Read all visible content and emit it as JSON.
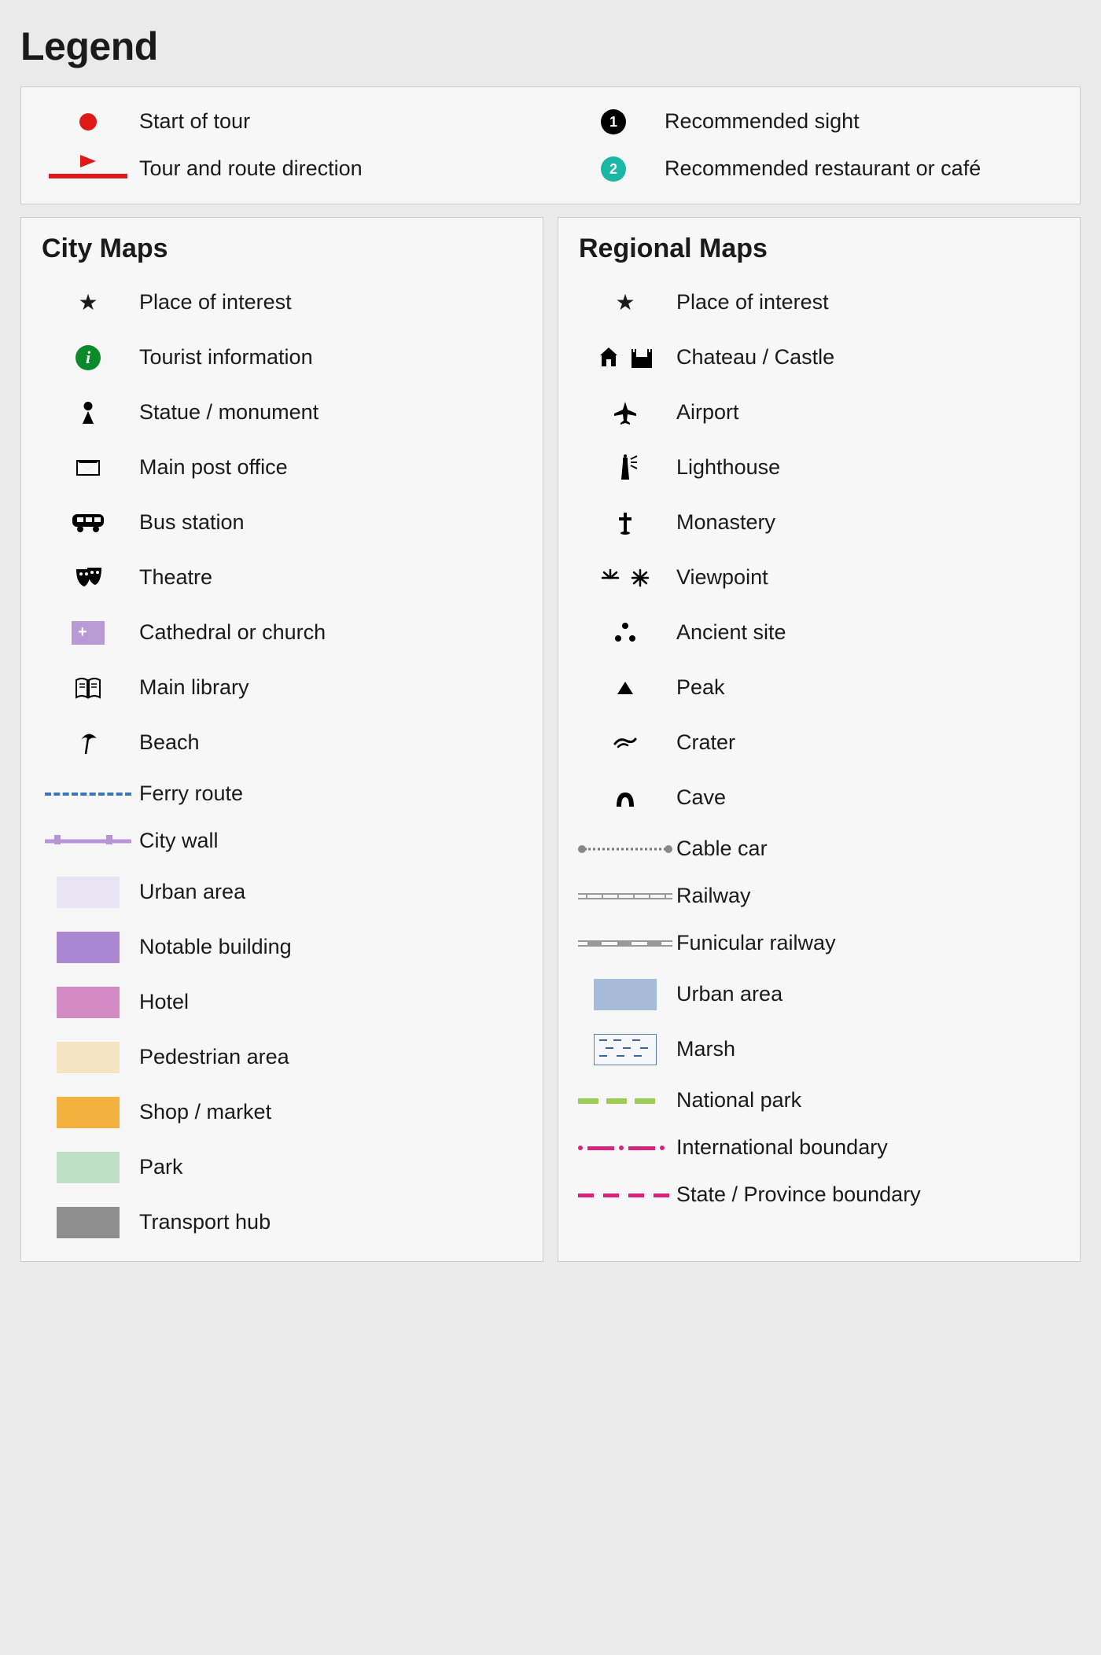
{
  "title": "Legend",
  "top": {
    "left": [
      {
        "label": "Start of tour"
      },
      {
        "label": "Tour and route direction"
      }
    ],
    "right": [
      {
        "num": "1",
        "label": "Recommended sight"
      },
      {
        "num": "2",
        "label": "Recommended restaurant or café"
      }
    ]
  },
  "city": {
    "title": "City Maps",
    "items": [
      {
        "label": "Place of interest"
      },
      {
        "label": "Tourist information"
      },
      {
        "label": "Statue / monument"
      },
      {
        "label": "Main post office"
      },
      {
        "label": "Bus station"
      },
      {
        "label": "Theatre"
      },
      {
        "label": "Cathedral or church"
      },
      {
        "label": "Main library"
      },
      {
        "label": "Beach"
      },
      {
        "label": "Ferry route"
      },
      {
        "label": "City wall"
      },
      {
        "label": "Urban area"
      },
      {
        "label": "Notable building"
      },
      {
        "label": "Hotel"
      },
      {
        "label": "Pedestrian area"
      },
      {
        "label": "Shop / market"
      },
      {
        "label": "Park"
      },
      {
        "label": "Transport hub"
      }
    ],
    "swatches": {
      "urban_area": "#e9e4f2",
      "notable_building": "#ab87d1",
      "hotel": "#d28bc3",
      "pedestrian": "#f5e4c4",
      "shop": "#f2b23d",
      "park": "#bfe0c4",
      "transport": "#8f8f8f"
    }
  },
  "regional": {
    "title": "Regional Maps",
    "items": [
      {
        "label": "Place of interest"
      },
      {
        "label": "Chateau / Castle"
      },
      {
        "label": "Airport"
      },
      {
        "label": "Lighthouse"
      },
      {
        "label": "Monastery"
      },
      {
        "label": "Viewpoint"
      },
      {
        "label": "Ancient site"
      },
      {
        "label": "Peak"
      },
      {
        "label": "Crater"
      },
      {
        "label": "Cave"
      },
      {
        "label": "Cable car"
      },
      {
        "label": "Railway"
      },
      {
        "label": "Funicular railway"
      },
      {
        "label": "Urban area"
      },
      {
        "label": "Marsh"
      },
      {
        "label": "National park"
      },
      {
        "label": "International boundary"
      },
      {
        "label": "State / Province boundary"
      }
    ],
    "swatches": {
      "urban_area": "#a7bcd9"
    }
  }
}
